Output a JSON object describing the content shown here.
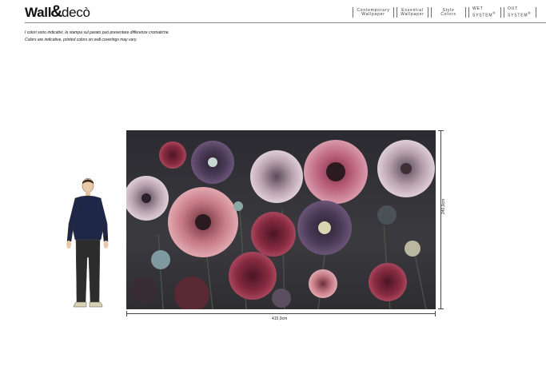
{
  "brand": {
    "logo_left": "Wall",
    "logo_amp": "&",
    "logo_right": "decò"
  },
  "nav": [
    {
      "line1": "Contemporary",
      "line2": "Wallpaper"
    },
    {
      "line1": "Essential",
      "line2": "Wallpaper"
    },
    {
      "line1": "Style",
      "line2": "Colors"
    },
    {
      "line1": "WET SYSTEM",
      "sup": "®"
    },
    {
      "line1": "OUT SYSTEM",
      "sup": "®"
    }
  ],
  "notes": {
    "it": "I colori sono indicativi, la stampa sul parato può presentare differenze cromatiche.",
    "en": "Colors are indicative, printed colors on wall coverings may vary."
  },
  "dimensions": {
    "height": "240,0cm",
    "width": "415,0cm"
  },
  "colors": {
    "mural_bg": "#2f2e33",
    "rule": "#8a8a8a"
  }
}
